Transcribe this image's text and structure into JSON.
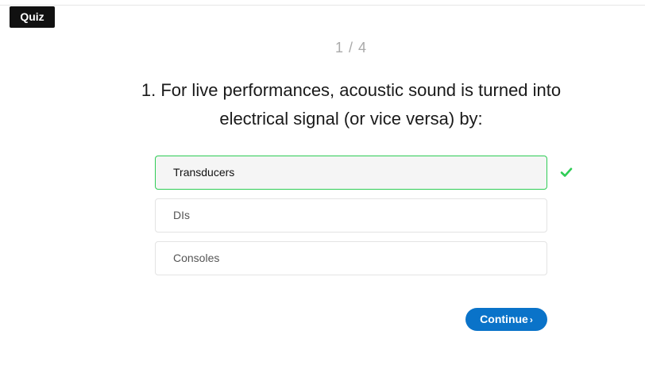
{
  "header": {
    "quiz_label": "Quiz"
  },
  "progress": {
    "text": "1 / 4",
    "current": 1,
    "total": 4
  },
  "question": {
    "text": "1. For live performances, acoustic sound is turned into electrical signal (or vice versa) by:"
  },
  "options": [
    {
      "label": "Transducers",
      "state": "correct"
    },
    {
      "label": "DIs",
      "state": "unselected"
    },
    {
      "label": "Consoles",
      "state": "unselected"
    }
  ],
  "feedback": {
    "icon": "check-icon",
    "color": "#2ecc55"
  },
  "actions": {
    "continue_label": "Continue",
    "continue_chevron": "›",
    "continue_color": "#0a73c9"
  }
}
